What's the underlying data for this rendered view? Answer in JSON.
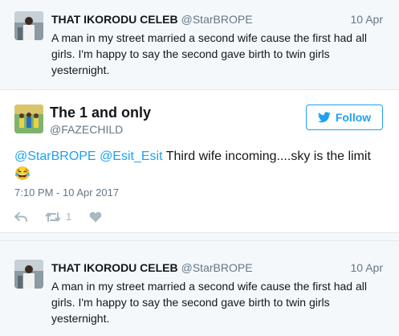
{
  "top_tweet": {
    "name": "THAT IKORODU CELEB",
    "handle": "@StarBROPE",
    "date": "10 Apr",
    "text_l1": "A man in my street married a second wife cause the first had all",
    "text_l2": "girls. I'm happy to say the second gave birth to twin girls",
    "text_l3": "yesternight."
  },
  "main_tweet": {
    "name": "The 1 and only",
    "handle": "@FAZECHILD",
    "follow_label": "Follow",
    "mention1": "@StarBROPE",
    "mention2": "@Esit_Esit",
    "text": "Third wife incoming....sky is the limit",
    "emoji": "😂",
    "timestamp": "7:10 PM - 10 Apr 2017",
    "retweet_count": "1",
    "icons": [
      "reply-icon",
      "retweet-icon",
      "like-icon"
    ]
  },
  "bottom_tweet": {
    "name": "THAT IKORODU CELEB",
    "handle": "@StarBROPE",
    "date": "10 Apr",
    "text_l1": "A man in my street married a second wife cause the first had all",
    "text_l2": "girls. I'm happy to say the second gave birth to twin girls",
    "text_l3": "yesternight."
  },
  "colors": {
    "accent": "#1da1f2",
    "muted": "#657786",
    "icon": "#aab8c2",
    "bg": "#f5f8fa"
  }
}
